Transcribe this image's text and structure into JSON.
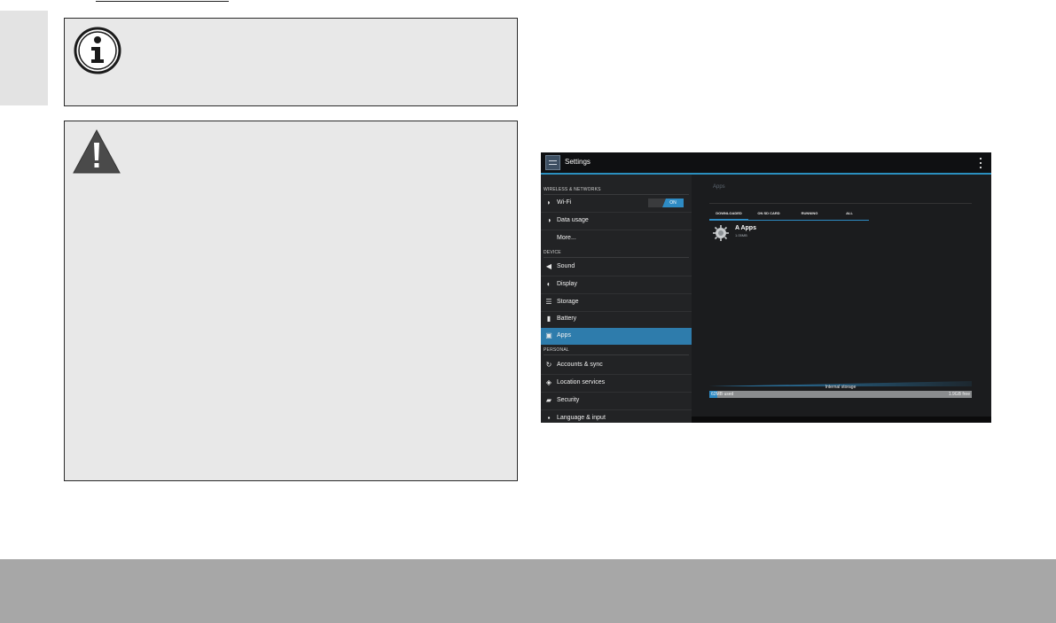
{
  "screenshot": {
    "title": "Settings",
    "sections": [
      {
        "header": "WIRELESS & NETWORKS"
      },
      {
        "header": "DEVICE"
      },
      {
        "header": "PERSONAL"
      }
    ],
    "items": {
      "wifi": "Wi-Fi",
      "wifi_toggle": "ON",
      "data_usage": "Data usage",
      "more": "More...",
      "sound": "Sound",
      "display": "Display",
      "storage": "Storage",
      "battery": "Battery",
      "apps": "Apps",
      "accounts": "Accounts & sync",
      "location": "Location services",
      "security": "Security",
      "language": "Language & input"
    },
    "right": {
      "title": "Apps",
      "tabs": [
        "DOWNLOADED",
        "ON SD CARD",
        "RUNNING",
        "ALL"
      ],
      "app_name": "A Apps",
      "app_size": "1.05MB",
      "storage_label": "Internal storage",
      "storage_used": "62MB used",
      "storage_free": "1.9GB free",
      "storage_used_fraction": 0.03
    }
  },
  "colors": {
    "accent": "#2e8bc4",
    "box_bg": "#e8e8e8",
    "footer": "#a7a7a7"
  }
}
